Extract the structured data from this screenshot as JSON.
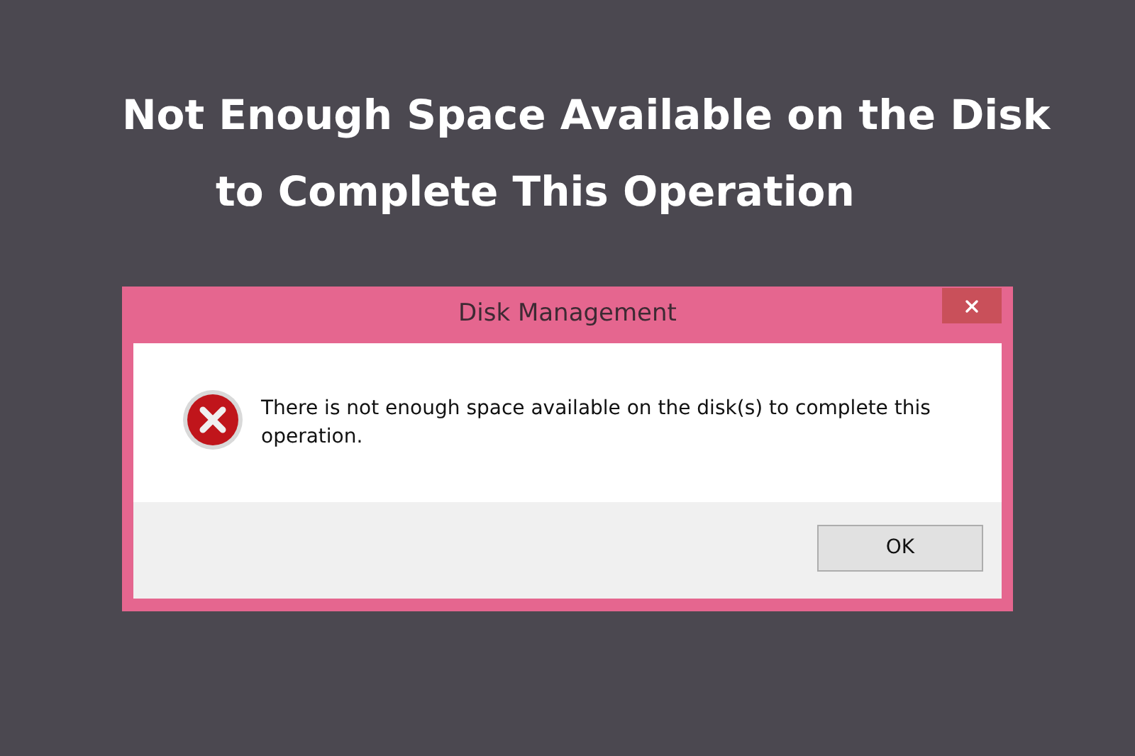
{
  "headline": [
    "Not Enough Space Available on the Disk",
    "to Complete This Operation"
  ],
  "dialog": {
    "title": "Disk Management",
    "message": "There is not enough space available on the disk(s) to complete this operation.",
    "buttons": [
      "OK"
    ]
  }
}
